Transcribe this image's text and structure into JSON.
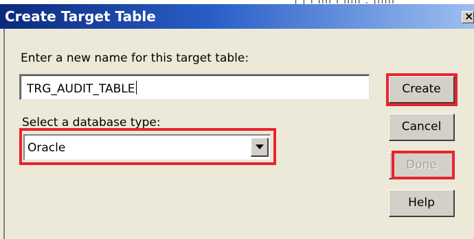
{
  "background_window": {
    "text": "| | ı ıııı ı ıılıı . |ıllıı"
  },
  "dialog": {
    "title": "Create Target Table",
    "close_glyph": "×",
    "name_prompt": "Enter a new name for this target table:",
    "name_value": "TRG_AUDIT_TABLE",
    "db_prompt": "Select a database type:",
    "db_selected": "Oracle",
    "buttons": {
      "create": "Create",
      "cancel": "Cancel",
      "done": "Done",
      "help": "Help"
    }
  },
  "colors": {
    "highlight_red": "#e8242e",
    "title_blue": "#0a2a7c",
    "dialog_bg": "#ece9d8"
  }
}
